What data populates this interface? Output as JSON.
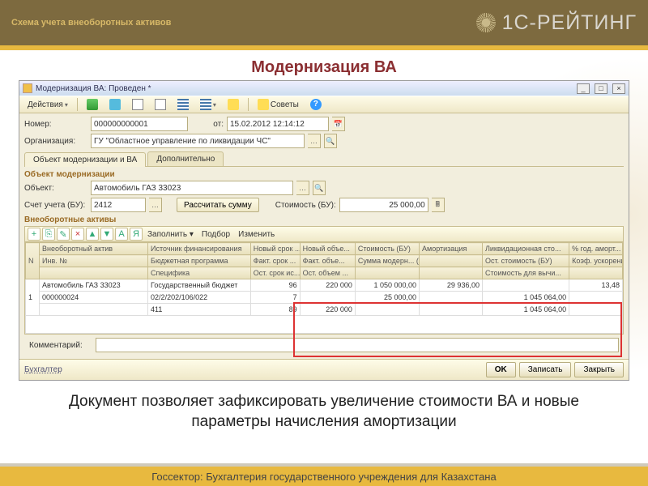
{
  "slide": {
    "breadcrumb": "Схема учета внеоборотных активов",
    "brand": "1С-РЕЙТИНГ",
    "title": "Модернизация ВА",
    "caption": "Документ позволяет зафиксировать увеличение стоимости ВА и новые параметры начисления амортизации",
    "footer": "Госсектор: Бухгалтерия государственного учреждения для Казахстана"
  },
  "window": {
    "title": "Модернизация ВА: Проведен *",
    "toolbar": {
      "actions": "Действия",
      "tips": "Советы"
    },
    "fields": {
      "number_label": "Номер:",
      "number": "000000000001",
      "from_label": "от:",
      "date": "15.02.2012 12:14:12",
      "org_label": "Организация:",
      "org": "ГУ \"Областное управление по ликвидации ЧС\""
    },
    "tabs": {
      "t1": "Объект модернизации и ВА",
      "t2": "Дополнительно"
    },
    "section1": "Объект модернизации",
    "object_label": "Объект:",
    "object": "Автомобиль ГАЗ 33023",
    "account_label": "Счет учета (БУ):",
    "account": "2412",
    "calc_btn": "Рассчитать сумму",
    "cost_label": "Стоимость (БУ):",
    "cost": "25 000,00",
    "section2": "Внеоборотные активы",
    "mini_tb": {
      "fill": "Заполнить",
      "select": "Подбор",
      "edit": "Изменить"
    },
    "headers": {
      "n": "N",
      "asset": "Внеоборотный актив",
      "fin": "Источник финансирования",
      "inv": "Инв. №",
      "prog": "Бюджетная программа",
      "spec": "Специфика",
      "new_term": "Новый срок ...",
      "new_vol": "Новый объе...",
      "cost_bu": "Стоимость (БУ)",
      "amort": "Амортизация",
      "fact_term": "Факт. срок ...",
      "fact_vol": "Факт. объе...",
      "sum_mod": "Сумма модерн... (БУ)",
      "ost_term": "Ост. срок ис...",
      "ost_vol": "Ост. объем ...",
      "liq": "Ликвидационная сто...",
      "ost_cost": "Ост. стоимость (БУ)",
      "calc_cost": "Стоимость для вычи...",
      "pct": "% год. аморт...",
      "koef": "Коэф. ускорения (БУ)"
    },
    "rows": [
      {
        "n": "1",
        "asset": "Автомобиль ГАЗ 33023",
        "fin": "Государственный бюджет",
        "inv": "000000024",
        "prog": "02/2/202/106/022",
        "spec": "411",
        "new_term": "96",
        "new_vol": "220 000",
        "cost_bu": "1 050 000,00",
        "amort": "29 936,00",
        "fact_term": "7",
        "sum_mod": "25 000,00",
        "ost_term": "89",
        "ost_vol": "220 000",
        "ost_cost": "1 045 064,00",
        "calc_cost": "1 045 064,00",
        "pct": "13,48"
      }
    ],
    "comment_label": "Комментарий:",
    "user": "Бухгалтер",
    "buttons": {
      "ok": "OK",
      "save": "Записать",
      "close": "Закрыть"
    }
  }
}
